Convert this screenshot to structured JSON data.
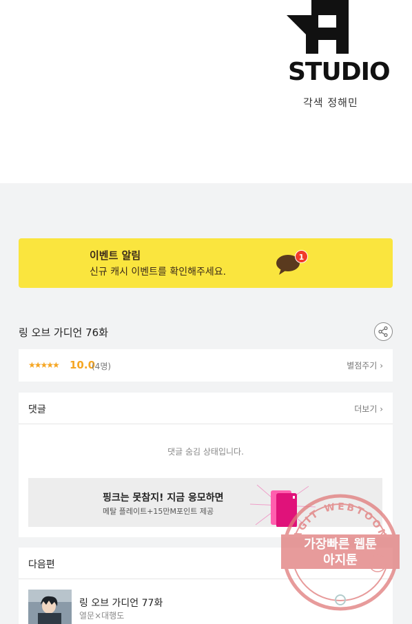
{
  "credit": "각색 정해민",
  "logo_text": "STUDIO",
  "event": {
    "title": "이벤트 알림",
    "subtitle": "신규 캐시 이벤트를 확인해주세요.",
    "badge_count": "1"
  },
  "episode": {
    "title": "링 오브 가디언 76화"
  },
  "rating": {
    "stars": "★★★★★",
    "score": "10.0",
    "count": "(4명)",
    "rate_link": "별점주기"
  },
  "comments": {
    "label": "댓글",
    "more_link": "더보기",
    "hidden_message": "댓글 숨김 상태입니다."
  },
  "ad": {
    "title": "핑크는 못참지! 지금 응모하면",
    "subtitle": "메탈 플레이트+15만M포인트 제공"
  },
  "next": {
    "label": "다음편",
    "title": "링 오브 가디언 77화",
    "author": "열문×대행도"
  },
  "watermark": {
    "ring_text": "AGIT WEBTOON",
    "line1": "가장빠른 웹툰",
    "line2": "아지툰"
  },
  "colors": {
    "event_bg": "#fae53e",
    "star": "#f5a623",
    "badge": "#f13b2a",
    "watermark": "#e07a7a"
  }
}
